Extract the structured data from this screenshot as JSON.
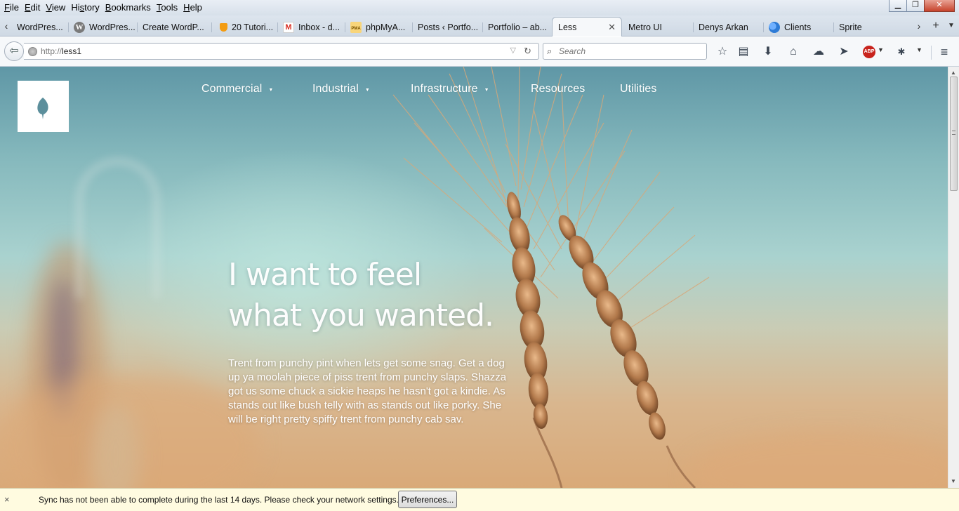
{
  "browser": {
    "menus": [
      {
        "label": "File",
        "accel": "F"
      },
      {
        "label": "Edit",
        "accel": "E"
      },
      {
        "label": "View",
        "accel": "V"
      },
      {
        "label": "History",
        "accel": "s"
      },
      {
        "label": "Bookmarks",
        "accel": "B"
      },
      {
        "label": "Tools",
        "accel": "T"
      },
      {
        "label": "Help",
        "accel": "H"
      }
    ],
    "menu_texts": [
      "File",
      "Edit",
      "View",
      "History",
      "Bookmarks",
      "Tools",
      "Help"
    ],
    "window_buttons": {
      "minimize": "▁",
      "maximize": "❐",
      "close": "✕"
    },
    "tabs": [
      {
        "label": "WordPres...",
        "icon": "wordpress-icon",
        "color": "#cfd7e0"
      },
      {
        "label": "WordPres...",
        "icon": "wordpress-icon",
        "color": "#7a7a7a"
      },
      {
        "label": "Create WordP...",
        "icon": "",
        "color": ""
      },
      {
        "label": "20 Tutori...",
        "icon": "fox-icon",
        "color": "#f39c12"
      },
      {
        "label": "Inbox - d...",
        "icon": "gmail-icon",
        "color": "#d93025"
      },
      {
        "label": "phpMyA...",
        "icon": "phpmyadmin-icon",
        "color": "#f0b000"
      },
      {
        "label": "Posts ‹ Portfo...",
        "icon": "",
        "color": ""
      },
      {
        "label": "Portfolio – ab...",
        "icon": "",
        "color": ""
      },
      {
        "label": "Less",
        "icon": "",
        "color": "",
        "active": true
      },
      {
        "label": "Metro UI",
        "icon": "",
        "color": ""
      },
      {
        "label": "Denys Arkan",
        "icon": "",
        "color": ""
      },
      {
        "label": "Clients",
        "icon": "clients-icon",
        "color": "#2d7bd6"
      },
      {
        "label": "Sprite",
        "icon": "",
        "color": ""
      }
    ],
    "tab_close": "✕",
    "url": {
      "scheme": "http://",
      "host": "less1"
    },
    "search_placeholder": "Search",
    "abp_label": "ABP"
  },
  "site": {
    "nav": [
      {
        "label": "Commercial",
        "has_caret": true
      },
      {
        "label": "Industrial",
        "has_caret": true
      },
      {
        "label": "Infrastructure",
        "has_caret": true
      },
      {
        "label": "Resources",
        "has_caret": false
      },
      {
        "label": "Utilities",
        "has_caret": false
      }
    ],
    "caret": "▼",
    "hero_line1": "I want to feel",
    "hero_line2": "what you wanted.",
    "body": "Trent from punchy pint when lets get some snag. Get a dog up ya moolah piece of piss trent from punchy slaps. Shazza got us some chuck a sickie heaps he hasn't got a kindie. As stands out like bush telly with as stands out like porky. She will be right pretty spiffy trent from punchy cab sav.",
    "colors": {
      "logo_leaf": "#5c8f9c",
      "sky_top": "#5f97a6",
      "field": "#d9a978"
    }
  },
  "notification": {
    "message": "Sync has not been able to complete during the last 14 days. Please check your network settings.",
    "button": "Preferences...",
    "close": "×"
  }
}
